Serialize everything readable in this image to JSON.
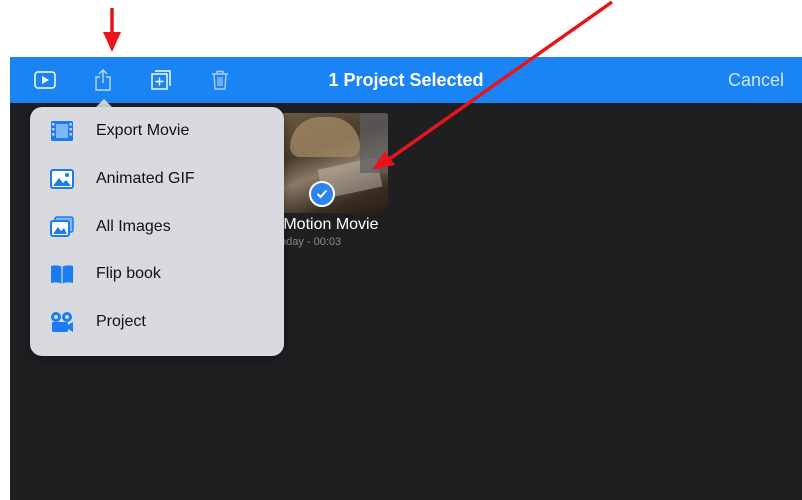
{
  "toolbar": {
    "title": "1 Project Selected",
    "cancel_label": "Cancel",
    "icons": [
      "play-icon",
      "share-icon",
      "add-icon",
      "trash-icon"
    ]
  },
  "project": {
    "title": "p Motion Movie",
    "meta": "oday - 00:03",
    "selected": true
  },
  "share_menu": {
    "items": [
      {
        "label": "Export Movie",
        "icon": "film-icon"
      },
      {
        "label": "Animated GIF",
        "icon": "image-icon"
      },
      {
        "label": "All Images",
        "icon": "images-icon"
      },
      {
        "label": "Flip book",
        "icon": "book-icon"
      },
      {
        "label": "Project",
        "icon": "camera-icon"
      }
    ]
  },
  "colors": {
    "toolbar": "#1a84f5",
    "background": "#1f1f21",
    "popover": "#d8dadf",
    "icon_blue": "#1a7cf0",
    "annotation_arrow": "#e8141b"
  }
}
